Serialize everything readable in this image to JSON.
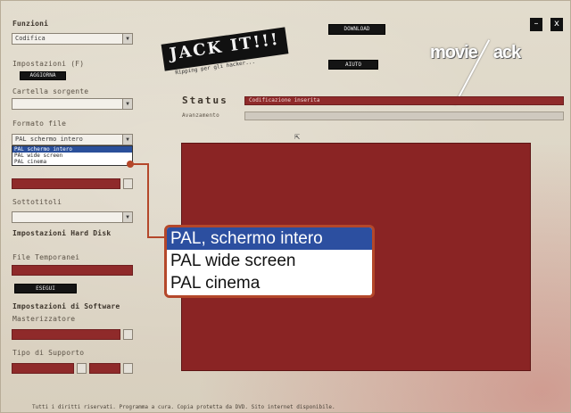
{
  "left": {
    "funzioni_label": "Funzioni",
    "funzioni_value": "Codifica",
    "impostazioni_label": "Impostazioni (F)",
    "aggiorna_button": "AGGIORNA",
    "cartella_label": "Cartella sorgente",
    "formato_label": "Formato file",
    "formato_value": "PAL schermo intero",
    "mini_options": [
      "PAL schermo intero",
      "PAL wide screen",
      "PAL cinema"
    ],
    "sottotitoli_label": "Sottotitoli",
    "impostazioni_hard_label": "Impostazioni Hard Disk",
    "file_temp_label": "File Temporanei",
    "esegui_button": "ESEGUI",
    "impostazioni_sw_label": "Impostazioni di Software",
    "masterizzatore_label": "Masterizzatore",
    "tipo_label": "Tipo di Supporto"
  },
  "header": {
    "logo_text": "JACK IT!!!",
    "logo_sub": "Ripping per gli hacker...",
    "btn1": "DOWNLOAD",
    "btn2": "AIUTO",
    "brand_left": "movie",
    "brand_right": "ack",
    "minimize": "–",
    "close": "x"
  },
  "status": {
    "label": "Status",
    "value": "Codificazione inserita",
    "avanzamento_label": "Avanzamento"
  },
  "callout": {
    "options": [
      "PAL, schermo intero",
      "PAL wide screen",
      "PAL cinema"
    ],
    "selected_index": 0
  },
  "footer": {
    "text": "Tutti i diritti riservati. Programma a cura. Copia protetta da DVD. Sito internet disponibile."
  }
}
